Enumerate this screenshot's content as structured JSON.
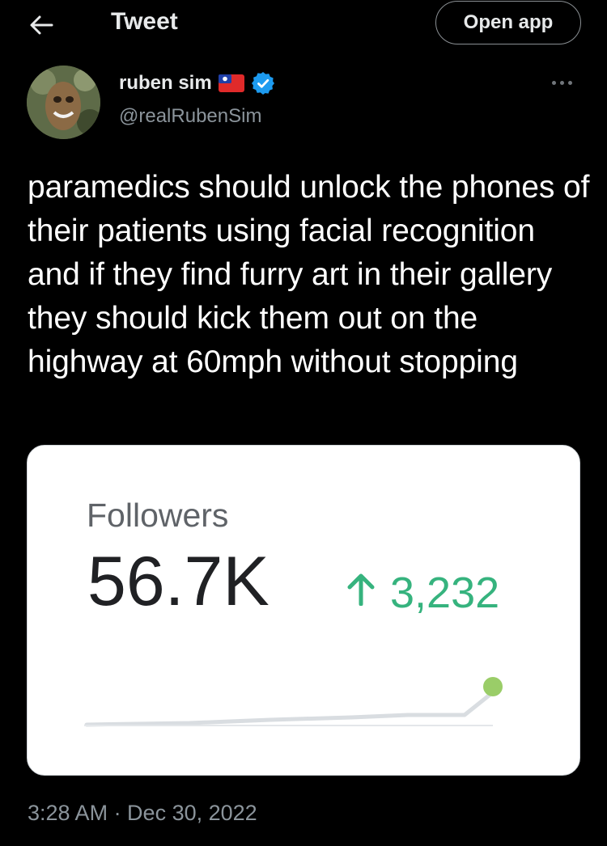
{
  "header": {
    "title": "Tweet",
    "open_app_label": "Open app"
  },
  "author": {
    "name": "ruben sim",
    "handle": "@realRubenSim",
    "verified": true,
    "flag": "taiwan-flag-emoji"
  },
  "tweet": {
    "text": "paramedics should unlock the phones of their patients using facial recognition and if they find furry art in their gallery they should kick them out on the highway at 60mph without stopping",
    "timestamp": "3:28 AM · Dec 30, 2022"
  },
  "embedded_card": {
    "label": "Followers",
    "value": "56.7K",
    "change": "3,232",
    "trend_icon": "arrow-up-icon",
    "colors": {
      "change": "#36b37e",
      "line": "#d9dde1",
      "dot": "#9acd68"
    }
  },
  "colors": {
    "background": "#000000",
    "verified_blue": "#1d9bf0"
  }
}
